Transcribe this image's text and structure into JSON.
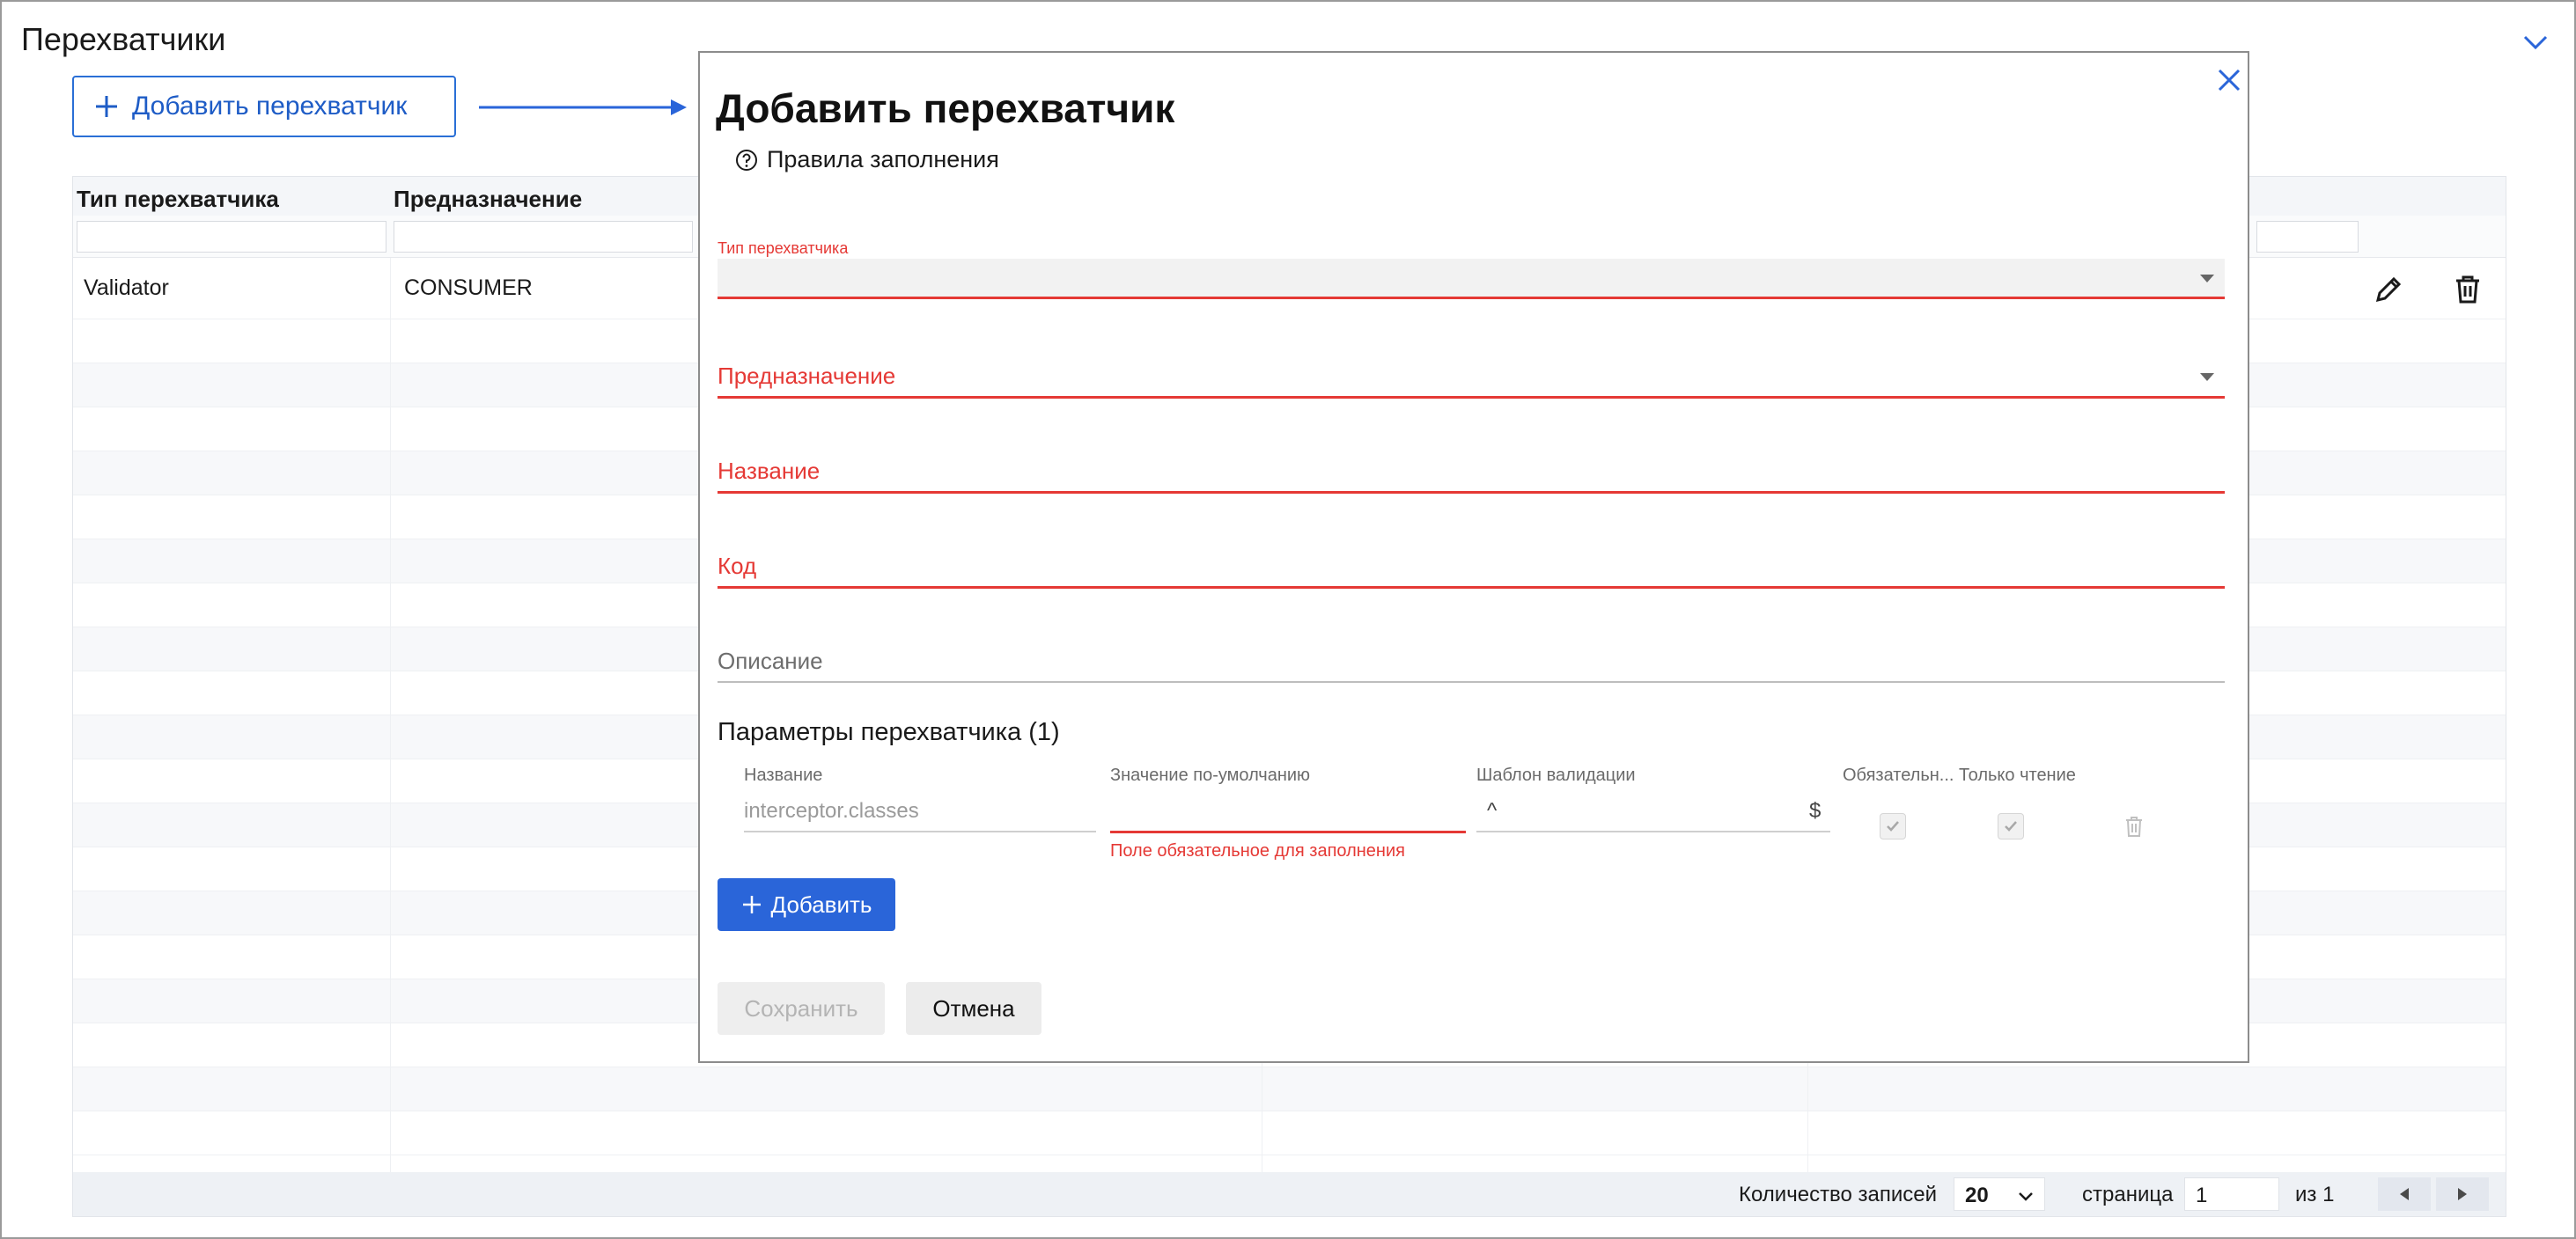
{
  "page": {
    "title": "Перехватчики",
    "add_button_label": "Добавить перехватчик"
  },
  "table": {
    "columns": [
      "Тип перехватчика",
      "Предназначение"
    ],
    "rows": [
      {
        "type": "Validator",
        "purpose": "CONSUMER"
      }
    ]
  },
  "pagination": {
    "records_label": "Количество записей",
    "page_size": "20",
    "page_label": "страница",
    "page_value": "1",
    "of_label": "из 1"
  },
  "modal": {
    "title": "Добавить перехватчик",
    "rules_link": "Правила заполнения",
    "fields": {
      "type_label": "Тип перехватчика",
      "purpose_label": "Предназначение",
      "name_label": "Название",
      "code_label": "Код",
      "description_label": "Описание"
    },
    "params": {
      "title": "Параметры перехватчика (1)",
      "headers": {
        "name": "Название",
        "default": "Значение по-умолчанию",
        "pattern": "Шаблон валидации",
        "required": "Обязательн...",
        "readonly": "Только чтение"
      },
      "row": {
        "name_placeholder": "interceptor.classes",
        "pattern_prefix": "^",
        "pattern_suffix": "$",
        "error": "Поле обязательное для заполнения"
      }
    },
    "add_param_label": "Добавить",
    "save_label": "Сохранить",
    "cancel_label": "Отмена"
  },
  "colors": {
    "accent": "#2a65d9",
    "error": "#e53935",
    "link": "#1e5cc6"
  },
  "icons": [
    "chevron-down-icon",
    "plus-icon",
    "arrow-right-icon",
    "pencil-icon",
    "trash-icon",
    "close-icon",
    "help-circle-icon",
    "check-icon",
    "triangle-left-icon",
    "triangle-right-icon"
  ]
}
